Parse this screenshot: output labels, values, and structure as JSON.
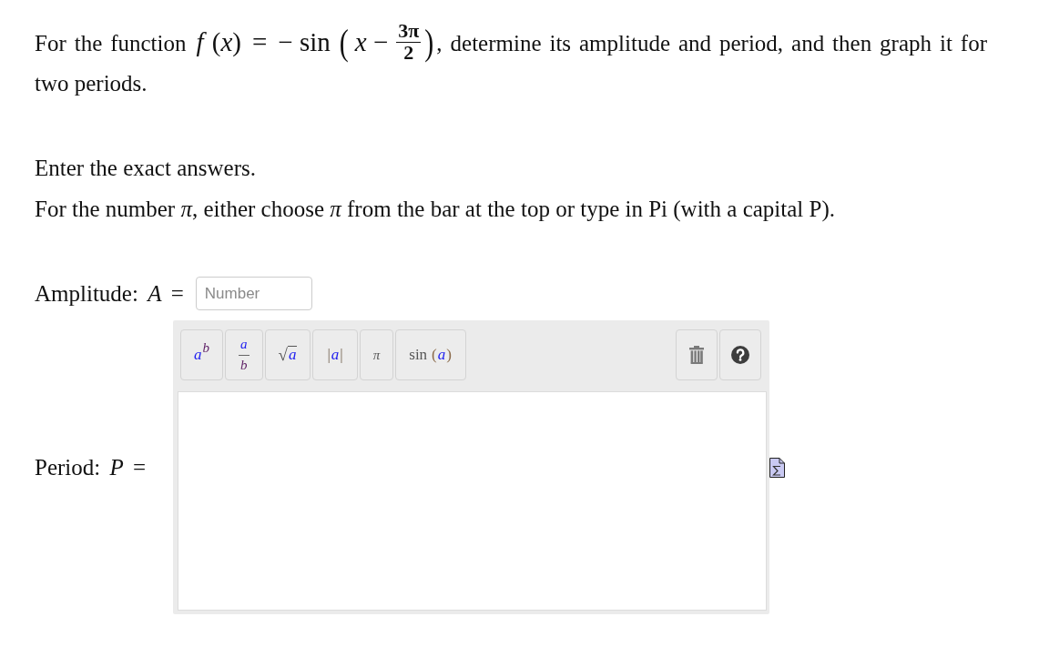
{
  "question": {
    "intro": "For the function",
    "formula": {
      "lhs": "*f* (*x*)",
      "equals": "=",
      "rhs": "− sin",
      "open": "(",
      "inner": "*x* −",
      "numerator": "3π",
      "denominator": "2",
      "close": ")"
    },
    "rest": ", determine its amplitude and period, and then graph it for two periods."
  },
  "instructions": [
    "Enter the exact answers.",
    "For the number *π*, either choose *π* from the bar at the top or type in Pi (with a capital P)."
  ],
  "amplitude": {
    "label": "Amplitude: *A* =",
    "placeholder": "Number"
  },
  "period": {
    "label": "Period: *P* =",
    "toolbar": [
      {
        "kind": "power",
        "base": "a",
        "exponent": "b"
      },
      {
        "kind": "fraction",
        "numerator": "a",
        "denominator": "b"
      },
      {
        "kind": "root",
        "symbol": "√",
        "argument": "a"
      },
      {
        "kind": "abs",
        "left": "|",
        "argument": "a",
        "right": "|"
      },
      {
        "kind": "constant",
        "label": "π"
      },
      {
        "kind": "function",
        "name": "sin",
        "left": "(",
        "argument": "a",
        "right": ")"
      }
    ]
  }
}
